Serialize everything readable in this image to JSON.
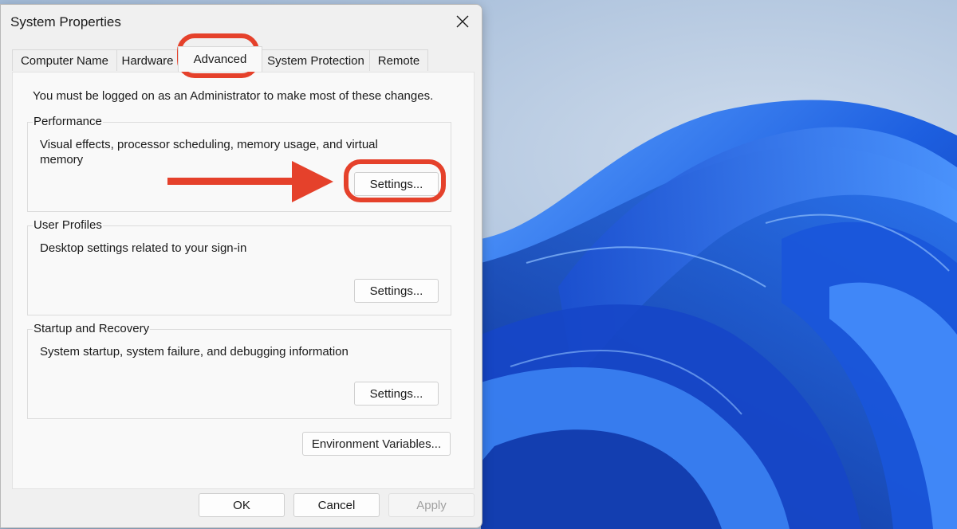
{
  "window": {
    "title": "System Properties",
    "close_glyph": "✕"
  },
  "tabs": [
    {
      "label": "Computer Name",
      "active": false
    },
    {
      "label": "Hardware",
      "active": false
    },
    {
      "label": "Advanced",
      "active": true
    },
    {
      "label": "System Protection",
      "active": false
    },
    {
      "label": "Remote",
      "active": false
    }
  ],
  "advanced": {
    "notice": "You must be logged on as an Administrator to make most of these changes.",
    "performance": {
      "legend": "Performance",
      "description": "Visual effects, processor scheduling, memory usage, and virtual memory",
      "button": "Settings..."
    },
    "user_profiles": {
      "legend": "User Profiles",
      "description": "Desktop settings related to your sign-in",
      "button": "Settings..."
    },
    "startup_recovery": {
      "legend": "Startup and Recovery",
      "description": "System startup, system failure, and debugging information",
      "button": "Settings..."
    },
    "env_button": "Environment Variables..."
  },
  "footer": {
    "ok": "OK",
    "cancel": "Cancel",
    "apply": "Apply",
    "apply_enabled": false
  },
  "annotations": {
    "color": "#e5412b",
    "highlighted": [
      "tab-advanced",
      "performance-settings-button"
    ],
    "arrow_icon": "right-arrow-icon"
  },
  "desktop": {
    "wallpaper": "windows-11-bloom",
    "accent": "#1d5fe0"
  }
}
